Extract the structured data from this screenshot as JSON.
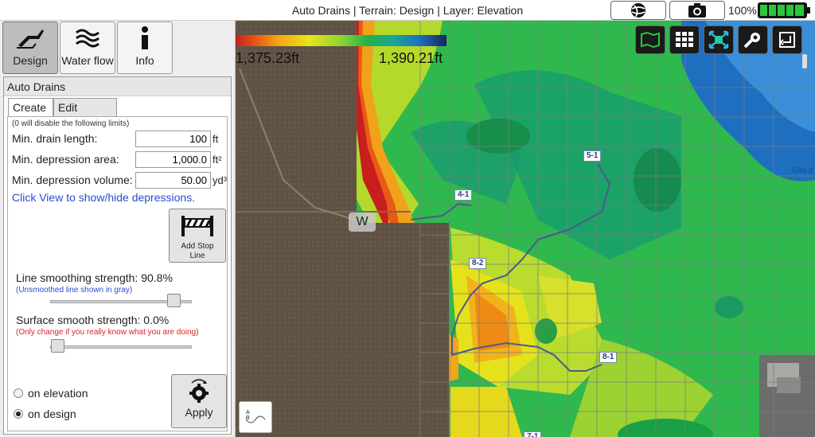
{
  "status_bar": {
    "title": "Auto Drains | Terrain: Design | Layer: Elevation",
    "battery_percent": "100%"
  },
  "modes": [
    {
      "label": "Design",
      "icon": "design-plow-icon",
      "active": true
    },
    {
      "label": "Water flow",
      "icon": "water-flow-icon",
      "active": false
    },
    {
      "label": "Info",
      "icon": "info-icon",
      "active": false
    }
  ],
  "panel": {
    "header": "Auto Drains",
    "tabs": [
      "Create",
      "Edit Drains"
    ],
    "active_tab": "Create",
    "note": "(0 will disable the following limits)",
    "fields": [
      {
        "label": "Min. drain length:",
        "value": "100",
        "unit": "ft"
      },
      {
        "label": "Min. depression area:",
        "value": "1,000.0",
        "unit": "ft²"
      },
      {
        "label": "Min. depression volume:",
        "value": "50.00",
        "unit": "yd³"
      }
    ],
    "link": "Click View to show/hide depressions.",
    "stop_button": "Add Stop Line",
    "line_smoothing": {
      "label": "Line smoothing strength: 90.8%",
      "sub": "(Unsmoothed line shown in gray)",
      "value": 0.908
    },
    "surface_smoothing": {
      "label": "Surface smooth strength: 0.0%",
      "sub": "(Only change if you really know what you are doing)",
      "value": 0.0
    },
    "radios": [
      {
        "label": "on elevation",
        "checked": false
      },
      {
        "label": "on design",
        "checked": true
      }
    ],
    "apply": "Apply"
  },
  "map": {
    "legend_min": "1,375.23ft",
    "legend_max": "1,390.21ft",
    "tools": [
      "layers-map-icon",
      "grid-icon",
      "fit-extent-icon",
      "settings-wrench-icon",
      "return-icon"
    ],
    "drain_labels": [
      "5-1",
      "4-1",
      "8-2",
      "8-1",
      "7-1"
    ],
    "w_label": "W",
    "gas_label": "Gas p",
    "ab_label": "A B"
  },
  "colors": {
    "low": "#c81e1e",
    "mid": "#e7e51a",
    "high": "#1a2260",
    "field_brown": "#5f5244",
    "accent_link": "#2a4cd0",
    "warning_text": "#e02020",
    "info_text": "#2a4cd0"
  }
}
